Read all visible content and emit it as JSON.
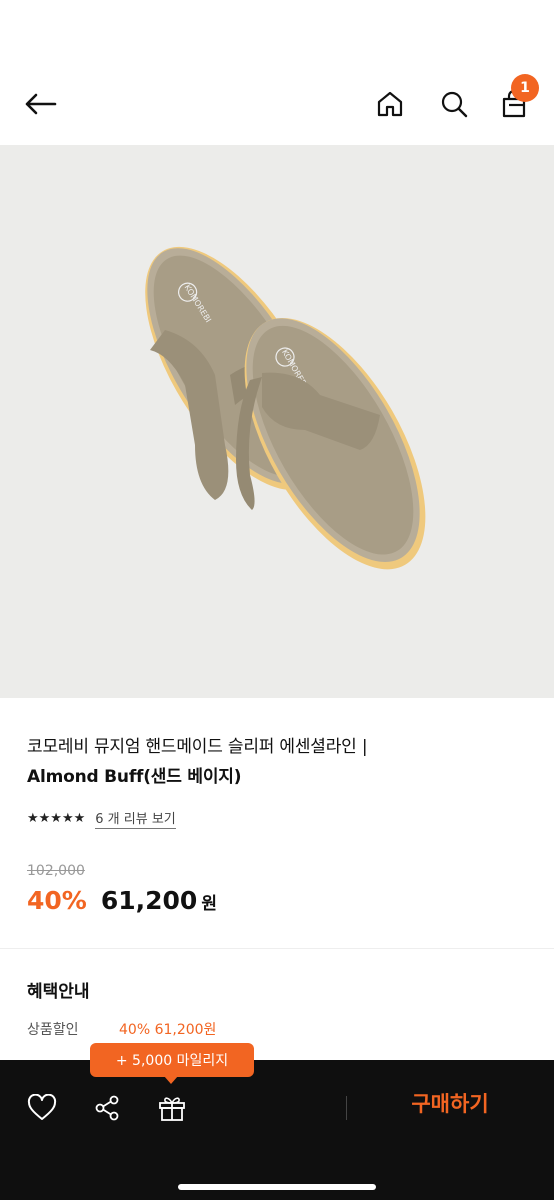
{
  "header": {
    "back_icon": "arrow-left-icon",
    "home_icon": "home-icon",
    "search_icon": "search-icon",
    "cart_icon": "shopping-bag-icon",
    "cart_count": "1"
  },
  "product": {
    "image_icon": "sandals-image",
    "title_line1": "코모레비 뮤지엄 핸드메이드 슬리퍼 에센셜라인 |",
    "title_line2": "Almond Buff(샌드 베이지)",
    "stars": "★★★★★",
    "rating": 4.5,
    "review_link": "6 개 리뷰 보기",
    "original_price": "102,000",
    "discount": "40%",
    "price": "61,200",
    "currency": "원"
  },
  "benefits": {
    "title": "혜택안내",
    "label": "상품할인",
    "value": "40% 61,200원"
  },
  "tooltip": {
    "text": "+ 5,000 마일리지"
  },
  "bottom_bar": {
    "heart_icon": "heart-icon",
    "share_icon": "share-icon",
    "gift_icon": "gift-icon",
    "buy_label": "구매하기"
  },
  "colors": {
    "accent": "#f26522",
    "bar_bg": "#0f0f0f",
    "image_bg": "#ececea"
  }
}
